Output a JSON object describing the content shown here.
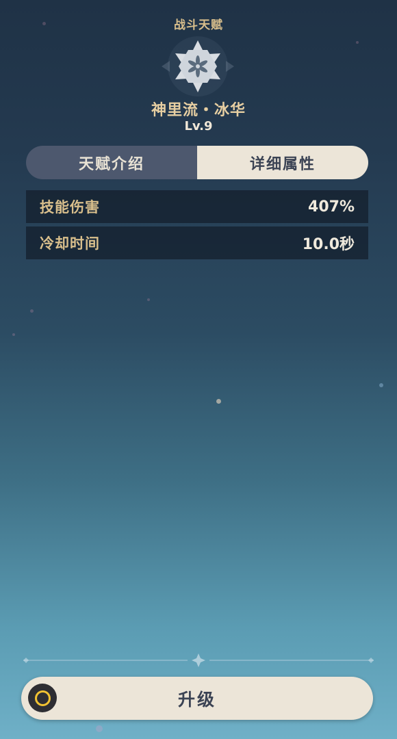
{
  "header": {
    "section_label": "战斗天赋"
  },
  "skill": {
    "icon": "snowflake-crest-icon",
    "name": "神里流・冰华",
    "level": "Lv.9"
  },
  "tabs": [
    {
      "label": "天赋介绍",
      "selected": false
    },
    {
      "label": "详细属性",
      "selected": true
    }
  ],
  "stats": [
    {
      "label": "技能伤害",
      "value": "407%"
    },
    {
      "label": "冷却时间",
      "value": "10.0秒"
    }
  ],
  "upgrade": {
    "label": "升级",
    "icon": "mora-coin-icon"
  },
  "colors": {
    "gold_text": "#d9bf8c",
    "cream": "#ece5d8",
    "dark_text": "#3b4354",
    "inactive_tab": "#4d586e",
    "coin": "#f1c232"
  }
}
